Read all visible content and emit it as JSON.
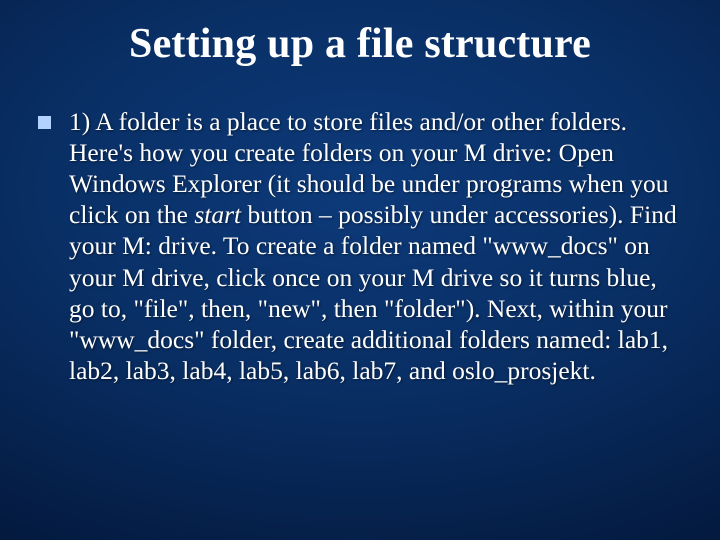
{
  "title": "Setting up a file structure",
  "bullet": {
    "part1": "1) A folder is a place to store files and/or other folders. Here's how you create folders on your M drive: Open Windows Explorer (it should be under programs when you click on the ",
    "italic": "start",
    "part2": " button – possibly under accessories). Find your M: drive.  To create a folder named \"www_docs\" on your M drive, click once on your M drive so it turns blue, go to, \"file\", then, \"new\", then \"folder\"). Next, within your \"www_docs\" folder, create additional folders named: lab1, lab2, lab3, lab4, lab5, lab6, lab7, and oslo_prosjekt."
  }
}
